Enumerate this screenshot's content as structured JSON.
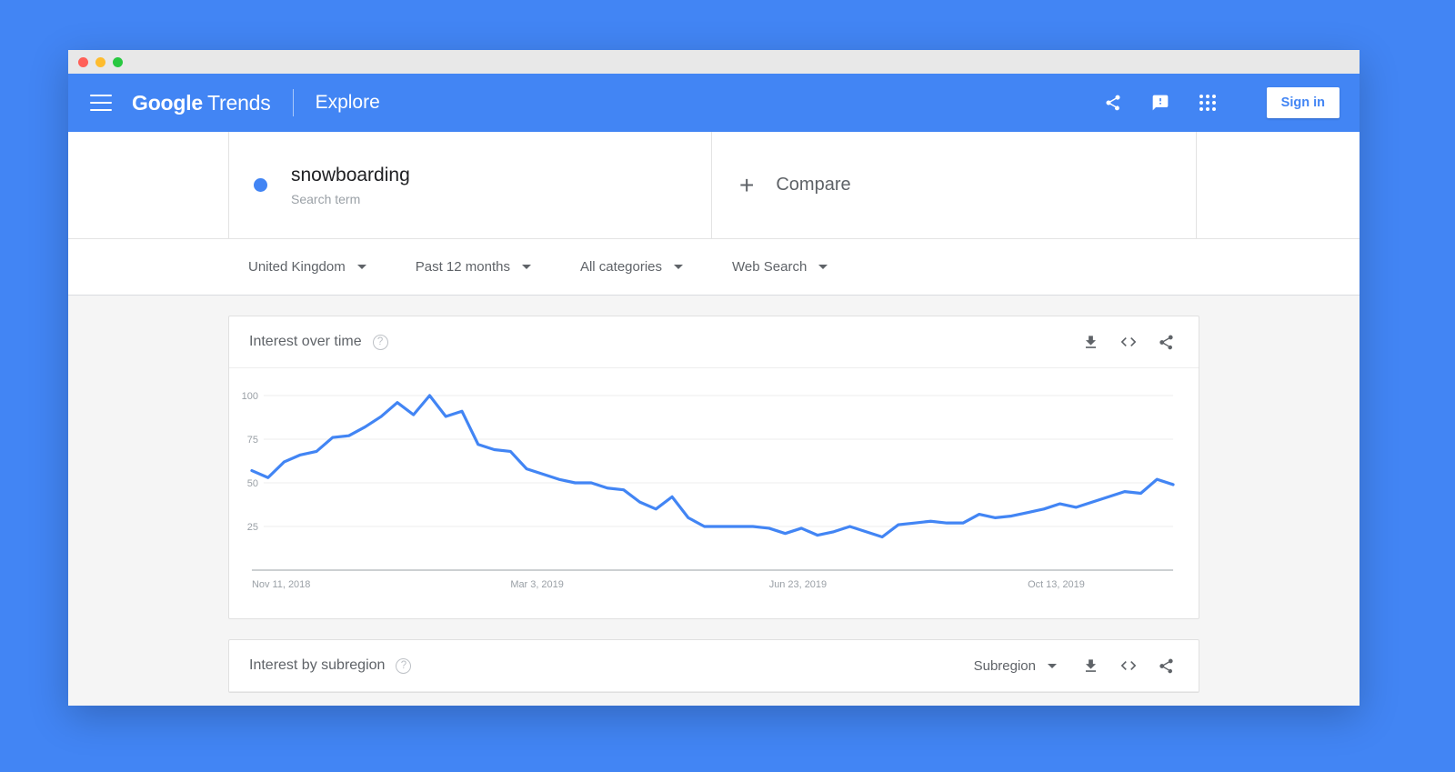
{
  "window": {
    "traffic_lights": [
      "close",
      "minimize",
      "maximize"
    ]
  },
  "header": {
    "menu_icon": "hamburger-menu-icon",
    "brand_primary": "Google",
    "brand_secondary": "Trends",
    "section": "Explore",
    "icons": [
      "share-icon",
      "feedback-icon",
      "apps-grid-icon"
    ],
    "signin_label": "Sign in"
  },
  "search": {
    "term": "snowboarding",
    "term_type": "Search term",
    "term_color": "#4285f4",
    "compare_label": "Compare",
    "compare_icon": "plus-icon"
  },
  "filters": [
    {
      "label": "United Kingdom",
      "name": "region"
    },
    {
      "label": "Past 12 months",
      "name": "time-range"
    },
    {
      "label": "All categories",
      "name": "category"
    },
    {
      "label": "Web Search",
      "name": "search-type"
    }
  ],
  "interest_over_time": {
    "title": "Interest over time",
    "help_glyph": "?",
    "actions": [
      "download-icon",
      "embed-icon",
      "share-icon"
    ]
  },
  "interest_by_subregion": {
    "title": "Interest by subregion",
    "help_glyph": "?",
    "dropdown_label": "Subregion",
    "actions": [
      "download-icon",
      "embed-icon",
      "share-icon"
    ]
  },
  "chart_data": {
    "type": "line",
    "title": "Interest over time",
    "xlabel": "",
    "ylabel": "",
    "ylim": [
      0,
      100
    ],
    "yticks": [
      25,
      50,
      75,
      100
    ],
    "grid": true,
    "legend_position": "none",
    "line_color": "#4285f4",
    "xtick_labels": [
      "Nov 11, 2018",
      "Mar 3, 2019",
      "Jun 23, 2019",
      "Oct 13, 2019"
    ],
    "xtick_positions": [
      0,
      16,
      32,
      48
    ],
    "series": [
      {
        "name": "snowboarding",
        "color": "#4285f4",
        "values": [
          57,
          53,
          62,
          66,
          68,
          76,
          77,
          82,
          88,
          96,
          89,
          100,
          88,
          91,
          72,
          69,
          68,
          58,
          55,
          52,
          50,
          50,
          47,
          46,
          39,
          35,
          42,
          30,
          25,
          25,
          25,
          25,
          24,
          21,
          24,
          20,
          22,
          25,
          22,
          19,
          26,
          27,
          28,
          27,
          27,
          32,
          30,
          31,
          33,
          35,
          38,
          36,
          39,
          42,
          45,
          44,
          52,
          49
        ]
      }
    ]
  }
}
